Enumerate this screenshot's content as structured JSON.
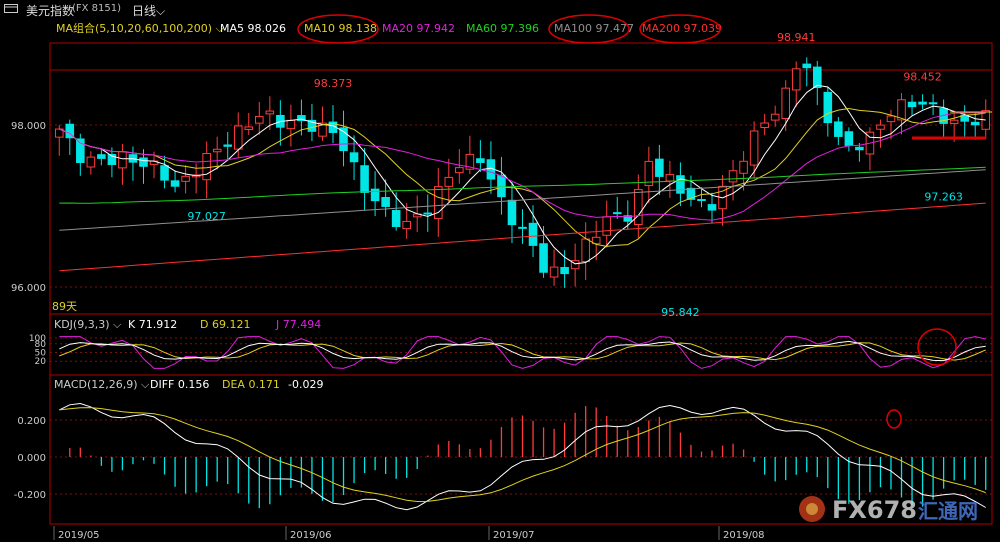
{
  "header": {
    "instrument": "美元指数",
    "code": "(FX 8151)",
    "period": "日线",
    "period_arrow": "⌵"
  },
  "watermark": {
    "text": "FX678",
    "sub": "汇通网"
  },
  "colors": {
    "up": "#ff3b3b",
    "down": "#00e5e5",
    "ma5": "#ffffff",
    "ma10": "#e0d020",
    "ma20": "#e020e0",
    "ma60": "#20d020",
    "ma100": "#909090",
    "ma200": "#ff3030",
    "kdj_k": "#ffffff",
    "kdj_d": "#e0d020",
    "kdj_j": "#e020e0",
    "macd_diff": "#ffffff",
    "macd_dea": "#e0d020",
    "annotation": "#e00000",
    "panel_border": "#b00000"
  },
  "chart_data": {
    "type": "candlestick",
    "x_dates": [
      "2019/05",
      "2019/06",
      "2019/07",
      "2019/08"
    ],
    "bars_count": 89,
    "bars_label": "89天",
    "y_ticks": [
      96.0,
      98.0
    ],
    "ylim": [
      95.8,
      99.0
    ],
    "legend_ma": {
      "title": "MA组合(5,10,20,60,100,200)",
      "items": [
        {
          "name": "MA5",
          "value": "98.026"
        },
        {
          "name": "MA10",
          "value": "98.138"
        },
        {
          "name": "MA20",
          "value": "97.942"
        },
        {
          "name": "MA60",
          "value": "97.396"
        },
        {
          "name": "MA100",
          "value": "97.477"
        },
        {
          "name": "MA200",
          "value": "97.039"
        }
      ]
    },
    "annotations": [
      {
        "label": "98.373",
        "bar": 26,
        "price": 98.373,
        "pos": "above"
      },
      {
        "label": "97.027",
        "bar": 14,
        "price": 97.027,
        "pos": "below"
      },
      {
        "label": "95.842",
        "bar": 59,
        "price": 95.842,
        "pos": "below"
      },
      {
        "label": "98.941",
        "bar": 70,
        "price": 98.941,
        "pos": "above"
      },
      {
        "label": "98.452",
        "bar": 82,
        "price": 98.452,
        "pos": "above"
      },
      {
        "label": "97.263",
        "bar": 84,
        "price": 97.263,
        "pos": "below"
      }
    ],
    "kdj": {
      "title": "KDJ(9,3,3)",
      "k": "71.912",
      "d": "69.121",
      "j": "77.494",
      "y_ticks": [
        20,
        50,
        80,
        100
      ],
      "ylim": [
        0,
        100
      ]
    },
    "macd": {
      "title": "MACD(12,26,9)",
      "diff": "0.156",
      "dea": "0.171",
      "macd": "-0.029",
      "y_ticks": [
        -0.2,
        0.0,
        0.2
      ],
      "ylim": [
        -0.35,
        0.35
      ]
    }
  }
}
